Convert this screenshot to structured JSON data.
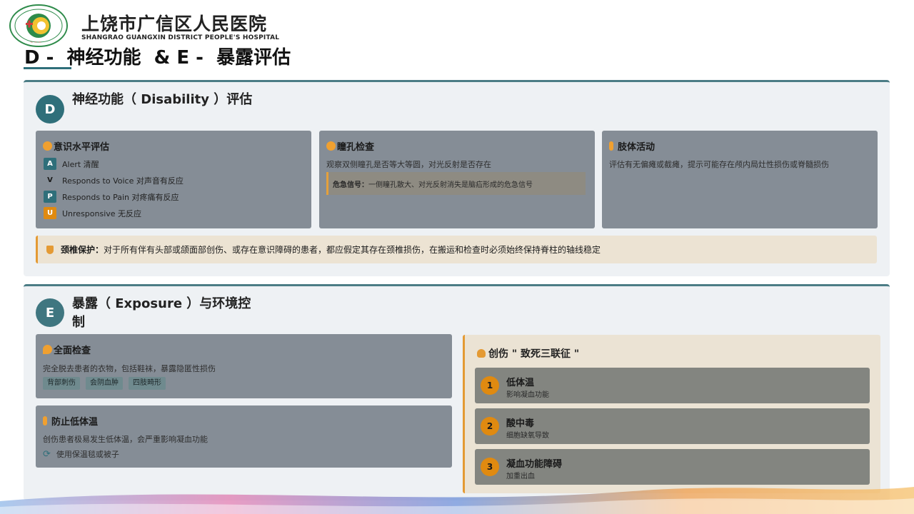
{
  "header": {
    "hospital_cn": "上饶市广信区人民医院",
    "hospital_en": "SHANGRAO GUANGXIN DISTRICT PEOPLE'S HOSPITAL",
    "page_title": "D -  神经功能  & E -  暴露评估"
  },
  "colors": {
    "accent_teal": "#2f6f7a",
    "accent_orange": "#e49a34",
    "card_gray": "#858d96",
    "warning_bg": "#ece3d3"
  },
  "disability": {
    "badge": "D",
    "title": "神经功能（  Disability  ）评估",
    "consciousness": {
      "title": "意识水平评估",
      "icon": "brain-icon",
      "levels": [
        {
          "code": "A",
          "label": "Alert  清醒",
          "color": "#2f6f7a"
        },
        {
          "code": "V",
          "label": "Responds to Voice  对声音有反应",
          "color": "#858d96"
        },
        {
          "code": "P",
          "label": "Responds to Pain  对疼痛有反应",
          "color": "#2f6f7a"
        },
        {
          "code": "U",
          "label": "Unresponsive  无反应",
          "color": "#e08a10"
        }
      ]
    },
    "pupil": {
      "title": "瞳孔检查",
      "icon": "eye-icon",
      "text": "观察双侧瞳孔是否等大等圆，对光反射是否存在",
      "danger_label": "危急信号：",
      "danger_text": "一侧瞳孔散大、对光反射消失是脑疝形成的危急信号"
    },
    "limb": {
      "title": "肢体活动",
      "icon": "person-walking-icon",
      "text": "评估有无偏瘫或截瘫，提示可能存在颅内局灶性损伤或脊髓损伤"
    },
    "spine_warning": {
      "label": "颈椎保护：",
      "text": "对于所有伴有头部或颌面部创伤、或存在意识障碍的患者，都应假定其存在颈椎损伤，在搬运和检查时必须始终保持脊柱的轴线稳定"
    }
  },
  "exposure": {
    "badge": "E",
    "title": "暴露（  Exposure  ）与环境控制",
    "full_exam": {
      "title": "全面检查",
      "icon": "search-icon",
      "text": "完全脱去患者的衣物，包括鞋袜，暴露隐匿性损伤",
      "tags": [
        "背部刺伤",
        "会阴血肿",
        "四肢畸形"
      ]
    },
    "hypothermia": {
      "title": "防止低体温",
      "icon": "thermometer-icon",
      "text": "创伤患者极易发生低体温，会严重影响凝血功能",
      "action": "使用保温毯或被子"
    },
    "triad": {
      "title": "创伤 \" 致死三联征 \"",
      "items": [
        {
          "num": "1",
          "name": "低体温",
          "desc": "影响凝血功能"
        },
        {
          "num": "2",
          "name": "酸中毒",
          "desc": "细胞缺氧导致"
        },
        {
          "num": "3",
          "name": "凝血功能障碍",
          "desc": "加重出血"
        }
      ]
    }
  }
}
